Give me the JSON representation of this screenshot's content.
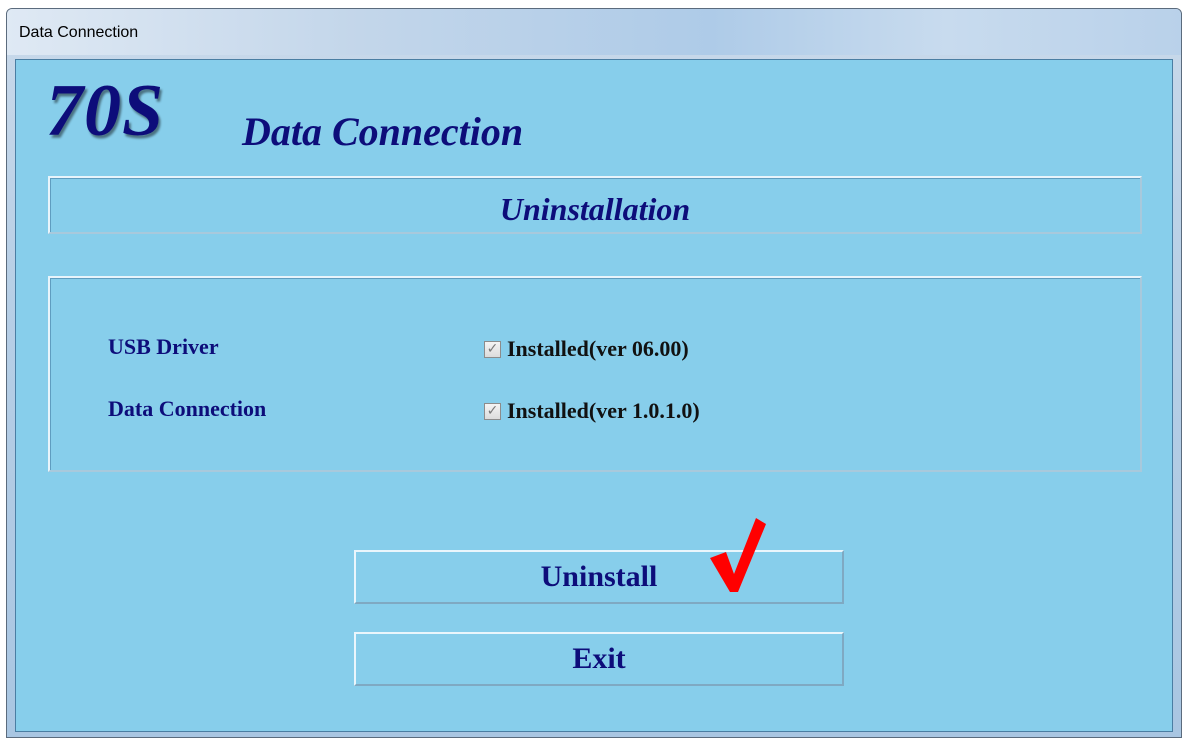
{
  "window": {
    "title": "Data Connection"
  },
  "header": {
    "model": "70S",
    "title": "Data Connection",
    "section": "Uninstallation"
  },
  "components": [
    {
      "label": "USB Driver",
      "checked": true,
      "status": "Installed(ver 06.00)"
    },
    {
      "label": "Data Connection",
      "checked": true,
      "status": "Installed(ver 1.0.1.0)"
    }
  ],
  "buttons": {
    "uninstall": "Uninstall",
    "exit": "Exit"
  },
  "colors": {
    "client_background": "#87ceeb",
    "text_navy": "#0d0d7a",
    "annotation_red": "#ff0000"
  },
  "annotation": {
    "icon": "red-check-mark-icon"
  }
}
